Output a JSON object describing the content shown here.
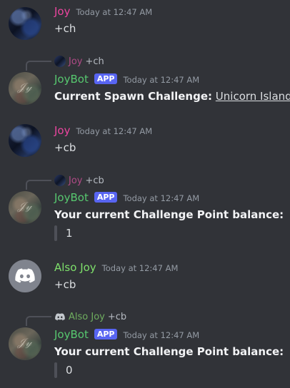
{
  "colors": {
    "background": "#313338",
    "joy": "#eb459f",
    "joybot": "#57c86f",
    "also_joy": "#7ee06b",
    "app_badge": "#5865f2"
  },
  "messages": [
    {
      "author": "Joy",
      "timestamp": "Today at 12:47 AM",
      "text": "+ch"
    },
    {
      "reply_to": {
        "author": "Joy",
        "text": "+ch"
      },
      "author": "JoyBot",
      "badge": "APP",
      "timestamp": "Today at 12:47 AM",
      "label": "Current Spawn Challenge:",
      "link": "Unicorn Island"
    },
    {
      "author": "Joy",
      "timestamp": "Today at 12:47 AM",
      "text": "+cb"
    },
    {
      "reply_to": {
        "author": "Joy",
        "text": "+cb"
      },
      "author": "JoyBot",
      "badge": "APP",
      "timestamp": "Today at 12:47 AM",
      "label": "Your current Challenge Point balance:",
      "value": "1"
    },
    {
      "author": "Also Joy",
      "timestamp": "Today at 12:47 AM",
      "text": "+cb",
      "avatar_icon": "discord-logo-icon"
    },
    {
      "reply_to": {
        "author": "Also Joy",
        "text": "+cb"
      },
      "author": "JoyBot",
      "badge": "APP",
      "timestamp": "Today at 12:47 AM",
      "label": "Your current Challenge Point balance:",
      "value": "0"
    }
  ]
}
